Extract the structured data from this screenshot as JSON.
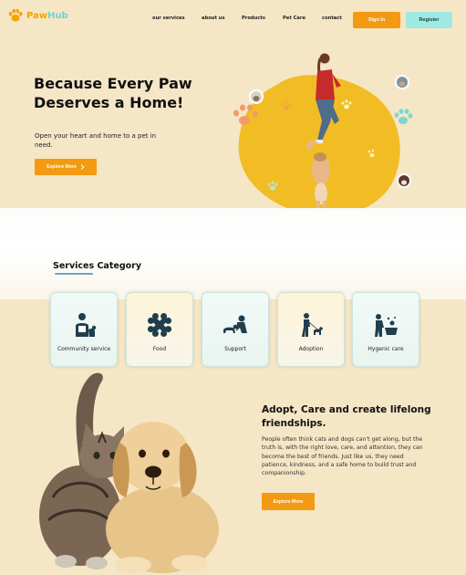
{
  "brand": {
    "name_part1": "Paw",
    "name_part2": "Hub",
    "icon": "paw-icon"
  },
  "nav": {
    "items": [
      {
        "label": "our services"
      },
      {
        "label": "about us"
      },
      {
        "label": "Products"
      },
      {
        "label": "Pet Care"
      },
      {
        "label": "contact"
      }
    ],
    "signin_label": "Sign In",
    "register_label": "Register"
  },
  "hero": {
    "title": "Because Every Paw Deserves a Home!",
    "subtitle": "Open your heart and home to a pet in need.",
    "cta_label": "Explore More",
    "cta_icon": "chevron-right-icon"
  },
  "services": {
    "title": "Services Category",
    "cards": [
      {
        "label": "Community service",
        "icon": "volunteer-with-dog-icon"
      },
      {
        "label": "Food",
        "icon": "bone-icon"
      },
      {
        "label": "Support",
        "icon": "person-with-dog-icon"
      },
      {
        "label": "Adoption",
        "icon": "walking-dog-icon"
      },
      {
        "label": "Hygenic care",
        "icon": "dog-bath-icon"
      }
    ]
  },
  "adopt": {
    "title": "Adopt, Care and create lifelong friendships.",
    "text": "People often think cats and dogs can't get along, but the truth is, with the right love, care, and attention, they can become the best of friends. Just like us, they need patience, kindness, and a safe home to build trust and companionship.",
    "cta_label": "Explore More"
  },
  "colors": {
    "background": "#f5e6c6",
    "accent_orange": "#f39a12",
    "accent_teal": "#9eeae3",
    "blob_yellow": "#f2bd24",
    "icon_dark": "#1f3e4e"
  }
}
